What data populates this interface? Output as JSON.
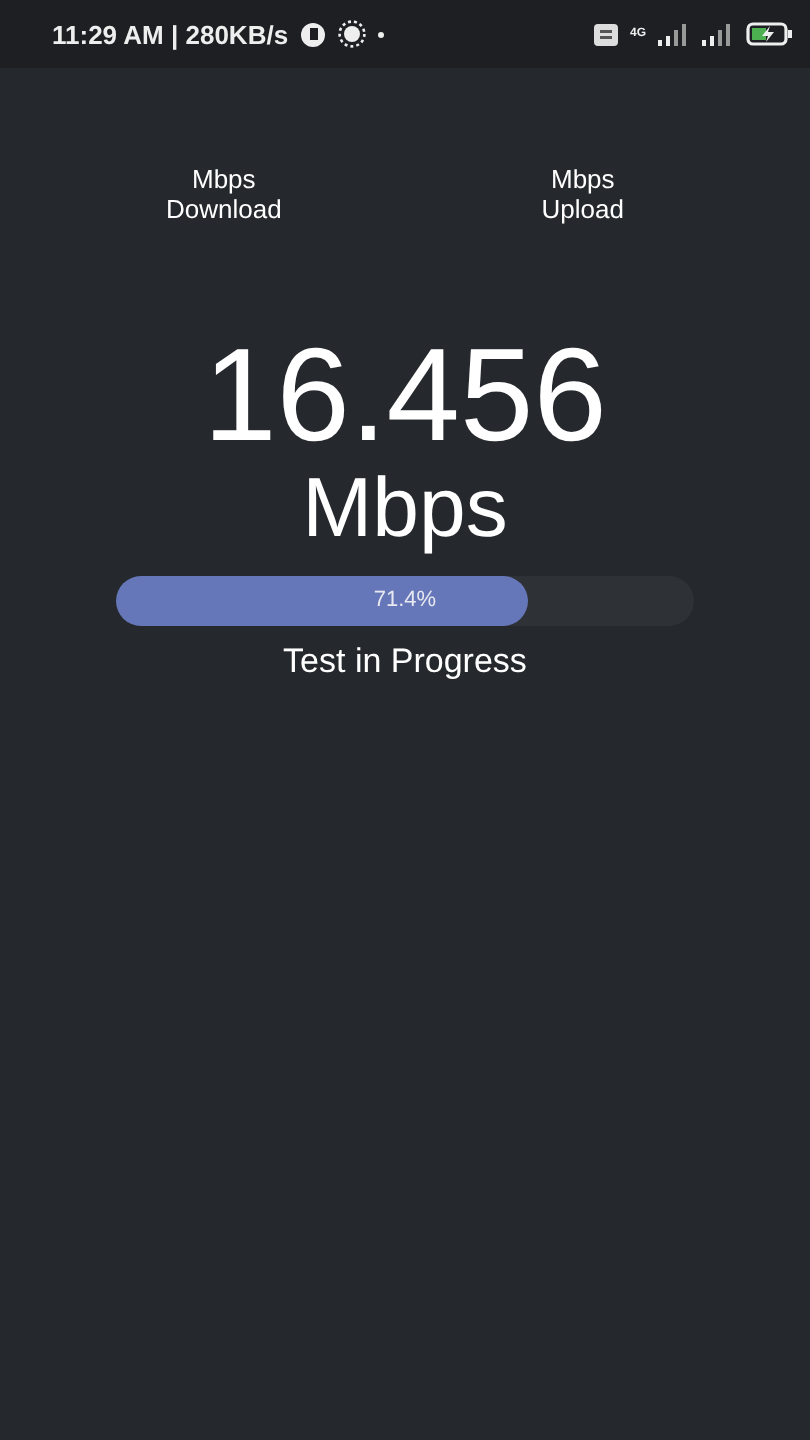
{
  "status_bar": {
    "time": "11:29 AM | 280KB/s",
    "network_type": "4G",
    "battery_charging": true
  },
  "stats": [
    {
      "unit": "Mbps",
      "label": "Download"
    },
    {
      "unit": "Mbps",
      "label": "Upload"
    }
  ],
  "speed": {
    "value": "16.456",
    "unit": "Mbps"
  },
  "progress": {
    "level": 0.714,
    "reading": "71.4%"
  },
  "status_text": "Test in Progress"
}
